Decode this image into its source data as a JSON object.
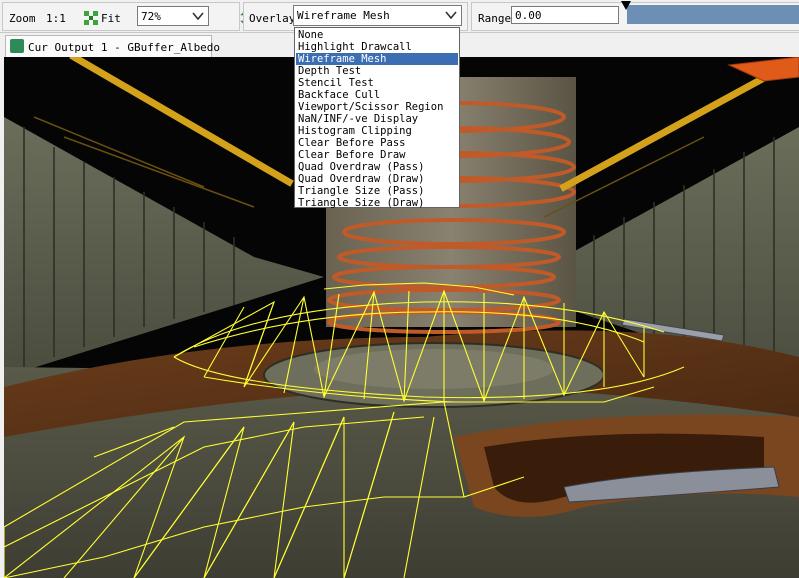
{
  "toolbar": {
    "zoom_label": "Zoom",
    "one_to_one": "1:1",
    "fit_label": "Fit",
    "zoom_value": "72%",
    "overlay_label": "Overlay",
    "overlay_value": "Wireframe Mesh",
    "range_label": "Range",
    "range_value": "0.00"
  },
  "tab": {
    "label": "Cur Output 1 - GBuffer_Albedo"
  },
  "overlay_menu": {
    "items": [
      "None",
      "Highlight Drawcall",
      "Wireframe Mesh",
      "Depth Test",
      "Stencil Test",
      "Backface Cull",
      "Viewport/Scissor Region",
      "NaN/INF/-ve Display",
      "Histogram Clipping",
      "Clear Before Pass",
      "Clear Before Draw",
      "Quad Overdraw (Pass)",
      "Quad Overdraw (Draw)",
      "Triangle Size (Pass)",
      "Triangle Size (Draw)"
    ],
    "selected_index": 2
  },
  "icons": {
    "fit": "fit-icon",
    "swap": "swap-arrows-icon",
    "tab": "texture-output-icon",
    "arrow": "chevron-down-icon"
  },
  "colors": {
    "accent": "#3c6eb4",
    "range_bar": "#6d8fb5",
    "wireframe": "#ffff33"
  }
}
